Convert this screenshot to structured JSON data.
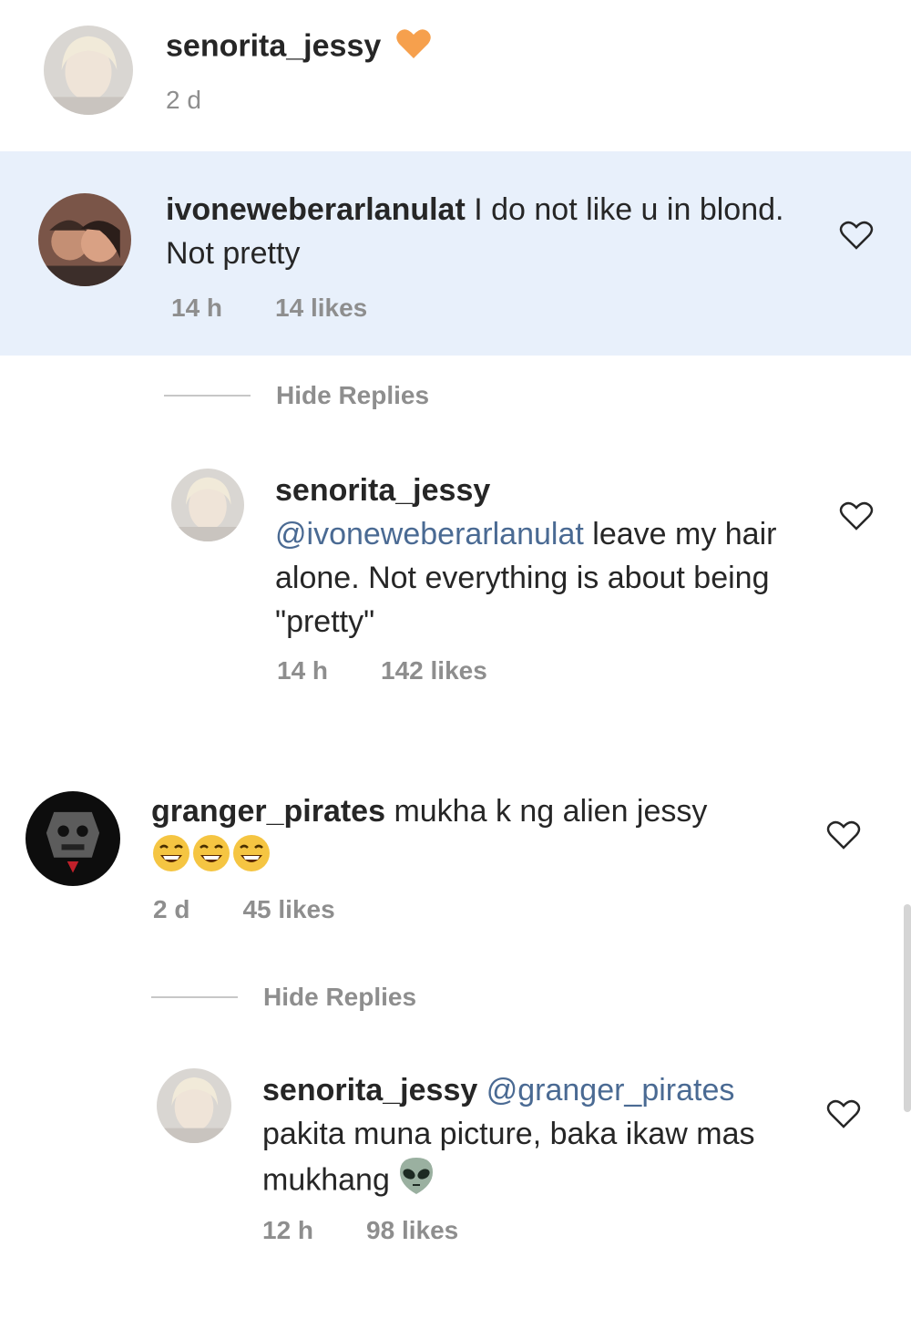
{
  "top_comment": {
    "username": "senorita_jessy",
    "emoji": "orange-heart",
    "time": "2 d"
  },
  "thread1": {
    "comment": {
      "username": "ivoneweberarlanulat",
      "text": " I do not like u in blond. Not pretty",
      "time": "14 h",
      "likes": "14 likes",
      "highlight_color": "#e8f0fb"
    },
    "hide_replies": "Hide Replies",
    "reply": {
      "username": "senorita_jessy",
      "mention": "@ivoneweberarlanulat",
      "text": " leave my hair alone. Not everything is about being \"pretty\"",
      "time": "14 h",
      "likes": "142 likes"
    }
  },
  "thread2": {
    "comment": {
      "username": "granger_pirates",
      "text": " mukha k ng alien jessy",
      "emojis": [
        "laughing-emoji",
        "laughing-emoji",
        "laughing-emoji"
      ],
      "time": "2 d",
      "likes": "45 likes"
    },
    "hide_replies": "Hide Replies",
    "reply": {
      "username": "senorita_jessy",
      "mention": "@granger_pirates",
      "text": " pakita muna picture, baka ikaw mas mukhang",
      "emoji": "alien-emoji",
      "time": "12 h",
      "likes": "98 likes"
    }
  },
  "colors": {
    "mention": "#4a6a93",
    "meta": "#8e8e8e",
    "highlight": "#e8f0fb",
    "orange_heart": "#f6a04d"
  }
}
